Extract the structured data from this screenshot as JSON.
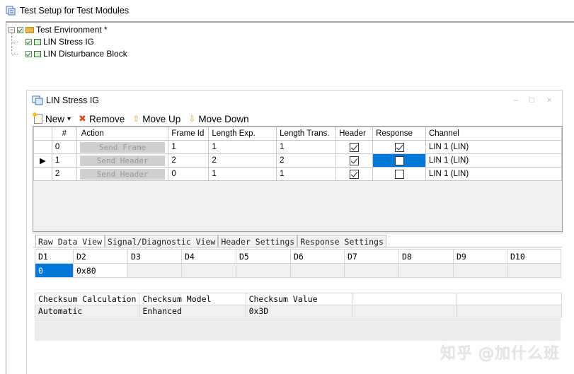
{
  "window": {
    "title": "Test Setup for Test Modules"
  },
  "tree": {
    "root": "Test Environment *",
    "children": [
      "LIN Stress IG",
      "LIN Disturbance Block"
    ]
  },
  "inner_window": {
    "title": "LIN Stress IG",
    "controls": [
      "–",
      "□",
      "×"
    ]
  },
  "toolbar": {
    "new": "New",
    "new_arrow": "▾",
    "remove": "Remove",
    "move_up": "Move Up",
    "move_down": "Move Down"
  },
  "grid": {
    "headers": [
      "#",
      "Action",
      "Frame Id",
      "Length Exp.",
      "Length Trans.",
      "Header",
      "Response",
      "Channel"
    ],
    "current_row_marker": "▶",
    "rows": [
      {
        "num": "0",
        "action": "Send Frame",
        "frame_id": "1",
        "len_exp": "1",
        "len_trans": "1",
        "header": true,
        "response": true,
        "channel": "LIN 1 (LIN)"
      },
      {
        "num": "1",
        "action": "Send Header",
        "frame_id": "2",
        "len_exp": "2",
        "len_trans": "2",
        "header": true,
        "response": false,
        "channel": "LIN 1 (LIN)"
      },
      {
        "num": "2",
        "action": "Send Header",
        "frame_id": "0",
        "len_exp": "1",
        "len_trans": "1",
        "header": true,
        "response": false,
        "channel": "LIN 1 (LIN)"
      }
    ]
  },
  "tabs": [
    "Raw Data View",
    "Signal/Diagnostic View",
    "Header Settings",
    "Response Settings"
  ],
  "raw_data": {
    "headers": [
      "D1",
      "D2",
      "D3",
      "D4",
      "D5",
      "D6",
      "D7",
      "D8",
      "D9",
      "D10"
    ],
    "values": [
      "0",
      "0x80",
      "",
      "",
      "",
      "",
      "",
      "",
      "",
      ""
    ]
  },
  "checksum": {
    "headers": [
      "Checksum Calculation",
      "Checksum Model",
      "Checksum Value",
      "",
      ""
    ],
    "values": [
      "Automatic",
      "Enhanced",
      "0x3D",
      "",
      ""
    ]
  },
  "watermark": "知乎 @加什么班",
  "colors": {
    "selection": "#0078d7",
    "disabled_button": "#cfcfcf"
  }
}
